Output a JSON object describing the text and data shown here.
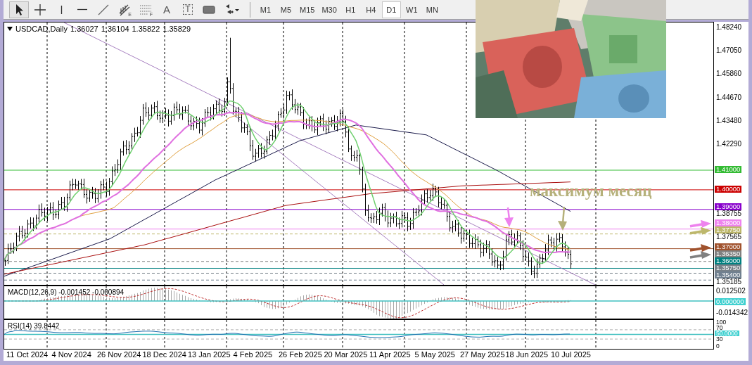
{
  "toolbar": {
    "tools": [
      {
        "kind": "cursor",
        "selected": true
      },
      {
        "kind": "crosshair",
        "selected": false
      },
      {
        "kind": "vline",
        "selected": false
      },
      {
        "kind": "hline",
        "selected": false
      },
      {
        "kind": "trendline",
        "selected": false
      },
      {
        "kind": "channel",
        "glyph": "E",
        "selected": false
      },
      {
        "kind": "gridlines",
        "glyph": "F",
        "selected": false
      },
      {
        "kind": "text",
        "glyph": "A",
        "selected": false
      },
      {
        "kind": "label",
        "glyph": "T",
        "selected": false
      },
      {
        "kind": "rectangle",
        "selected": false
      },
      {
        "kind": "arrows",
        "selected": false
      }
    ],
    "timeframes": [
      {
        "label": "M1",
        "selected": false
      },
      {
        "label": "M5",
        "selected": false
      },
      {
        "label": "M15",
        "selected": false
      },
      {
        "label": "M30",
        "selected": false
      },
      {
        "label": "H1",
        "selected": false
      },
      {
        "label": "H4",
        "selected": false
      },
      {
        "label": "D1",
        "selected": true
      },
      {
        "label": "W1",
        "selected": false
      },
      {
        "label": "MN",
        "selected": false
      }
    ]
  },
  "chart": {
    "symbol": "USDCAD,Daily",
    "quotes": [
      "1.36027",
      "1.36104",
      "1.35822",
      "1.35829"
    ],
    "annotation": "максимум месяц",
    "price_ticks": [
      "1.48240",
      "1.47050",
      "1.45860",
      "1.44670",
      "1.43480",
      "1.42290",
      "1.38755",
      "1.37565",
      "1.35185"
    ],
    "levels": [
      {
        "label": "1.41000",
        "color": "#33bb33",
        "kind": "solid",
        "arrow": false
      },
      {
        "label": "1.40000",
        "color": "#cc0000",
        "kind": "solid",
        "arrow": false
      },
      {
        "label": "1.39000",
        "color": "#8800cc",
        "kind": "solid",
        "arrow": false
      },
      {
        "label": "1.38000",
        "color": "#ee82ee",
        "kind": "solid",
        "arrow": true
      },
      {
        "label": "1.37750",
        "color": "#bdb76b",
        "kind": "dashed",
        "arrow": true
      },
      {
        "label": "1.37000",
        "color": "#a0522d",
        "kind": "solid",
        "arrow": true
      },
      {
        "label": "1.36350",
        "color": "#808080",
        "kind": "dashed",
        "arrow": true
      },
      {
        "label": "1.36000",
        "color": "#008080",
        "kind": "solid",
        "arrow": false
      },
      {
        "label": "1.35750",
        "color": "#778088",
        "kind": "dashed",
        "arrow": false
      },
      {
        "label": "1.35400",
        "color": "#708090",
        "kind": "dashed",
        "arrow": false
      }
    ]
  },
  "macd": {
    "label": "MACD(12,26,9) -0.001452 -0.000894",
    "ticks": [
      "0.012502",
      "-0.014342"
    ],
    "zero_badge": "0.000000"
  },
  "rsi": {
    "label": "RSI(14) 39.8442",
    "ticks": [
      "100",
      "70",
      "30",
      "0"
    ],
    "mid_badge": "50.0000"
  },
  "dates": [
    "11 Oct 2024",
    "4 Nov 2024",
    "26 Nov 2024",
    "18 Dec 2024",
    "13 Jan 2025",
    "4 Feb 2025",
    "26 Feb 2025",
    "20 Mar 2025",
    "11 Apr 2025",
    "5 May 2025",
    "27 May 2025",
    "18 Jun 2025",
    "10 Jul 2025"
  ]
}
